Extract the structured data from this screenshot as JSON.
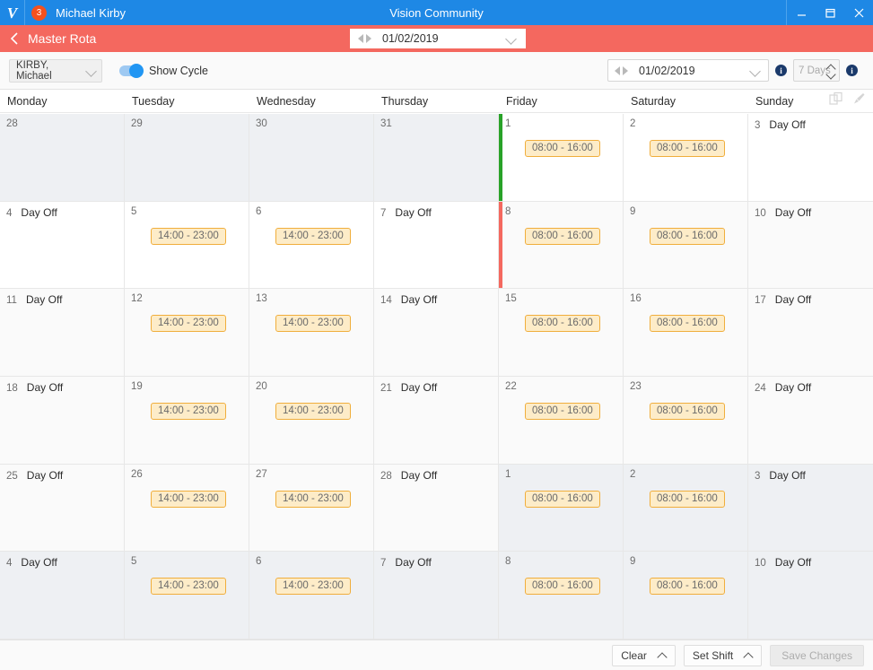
{
  "titlebar": {
    "logo": "vision-logo",
    "badge_count": "3",
    "user_name": "Michael Kirby",
    "app_title": "Vision Community",
    "minimize": "minimize-icon",
    "maximize": "maximize-icon",
    "close": "close-icon"
  },
  "subheader": {
    "back": "back-chevron-icon",
    "page_title": "Master Rota",
    "date_value": "01/02/2019"
  },
  "toolbar": {
    "staff_value": "KIRBY, Michael",
    "show_cycle_label": "Show Cycle",
    "show_cycle_on": true,
    "date_value": "01/02/2019",
    "days_value": "7 Days",
    "info_label": "i"
  },
  "day_headers": [
    "Monday",
    "Tuesday",
    "Wednesday",
    "Thursday",
    "Friday",
    "Saturday",
    "Sunday"
  ],
  "header_icons": [
    "copy-icon",
    "brush-icon"
  ],
  "calendar": {
    "weeks": [
      [
        {
          "day": "28",
          "state": "out",
          "label": "",
          "shift": "",
          "marker": ""
        },
        {
          "day": "29",
          "state": "out",
          "label": "",
          "shift": "",
          "marker": ""
        },
        {
          "day": "30",
          "state": "out",
          "label": "",
          "shift": "",
          "marker": ""
        },
        {
          "day": "31",
          "state": "out",
          "label": "",
          "shift": "",
          "marker": ""
        },
        {
          "day": "1",
          "state": "white",
          "label": "",
          "shift": "08:00 - 16:00",
          "marker": "green"
        },
        {
          "day": "2",
          "state": "white",
          "label": "",
          "shift": "08:00 - 16:00",
          "marker": ""
        },
        {
          "day": "3",
          "state": "white",
          "label": "Day Off",
          "shift": "",
          "marker": ""
        }
      ],
      [
        {
          "day": "4",
          "state": "white",
          "label": "Day Off",
          "shift": "",
          "marker": ""
        },
        {
          "day": "5",
          "state": "white",
          "label": "",
          "shift": "14:00 - 23:00",
          "marker": ""
        },
        {
          "day": "6",
          "state": "white",
          "label": "",
          "shift": "14:00 - 23:00",
          "marker": ""
        },
        {
          "day": "7",
          "state": "white",
          "label": "Day Off",
          "shift": "",
          "marker": ""
        },
        {
          "day": "8",
          "state": "past",
          "label": "",
          "shift": "08:00 - 16:00",
          "marker": "red"
        },
        {
          "day": "9",
          "state": "past",
          "label": "",
          "shift": "08:00 - 16:00",
          "marker": ""
        },
        {
          "day": "10",
          "state": "past",
          "label": "Day Off",
          "shift": "",
          "marker": ""
        }
      ],
      [
        {
          "day": "11",
          "state": "past",
          "label": "Day Off",
          "shift": "",
          "marker": ""
        },
        {
          "day": "12",
          "state": "past",
          "label": "",
          "shift": "14:00 - 23:00",
          "marker": ""
        },
        {
          "day": "13",
          "state": "past",
          "label": "",
          "shift": "14:00 - 23:00",
          "marker": ""
        },
        {
          "day": "14",
          "state": "past",
          "label": "Day Off",
          "shift": "",
          "marker": ""
        },
        {
          "day": "15",
          "state": "past",
          "label": "",
          "shift": "08:00 - 16:00",
          "marker": ""
        },
        {
          "day": "16",
          "state": "past",
          "label": "",
          "shift": "08:00 - 16:00",
          "marker": ""
        },
        {
          "day": "17",
          "state": "past",
          "label": "Day Off",
          "shift": "",
          "marker": ""
        }
      ],
      [
        {
          "day": "18",
          "state": "past",
          "label": "Day Off",
          "shift": "",
          "marker": ""
        },
        {
          "day": "19",
          "state": "past",
          "label": "",
          "shift": "14:00 - 23:00",
          "marker": ""
        },
        {
          "day": "20",
          "state": "past",
          "label": "",
          "shift": "14:00 - 23:00",
          "marker": ""
        },
        {
          "day": "21",
          "state": "past",
          "label": "Day Off",
          "shift": "",
          "marker": ""
        },
        {
          "day": "22",
          "state": "past",
          "label": "",
          "shift": "08:00 - 16:00",
          "marker": ""
        },
        {
          "day": "23",
          "state": "past",
          "label": "",
          "shift": "08:00 - 16:00",
          "marker": ""
        },
        {
          "day": "24",
          "state": "past",
          "label": "Day Off",
          "shift": "",
          "marker": ""
        }
      ],
      [
        {
          "day": "25",
          "state": "past",
          "label": "Day Off",
          "shift": "",
          "marker": ""
        },
        {
          "day": "26",
          "state": "past",
          "label": "",
          "shift": "14:00 - 23:00",
          "marker": ""
        },
        {
          "day": "27",
          "state": "past",
          "label": "",
          "shift": "14:00 - 23:00",
          "marker": ""
        },
        {
          "day": "28",
          "state": "past",
          "label": "Day Off",
          "shift": "",
          "marker": ""
        },
        {
          "day": "1",
          "state": "out",
          "label": "",
          "shift": "08:00 - 16:00",
          "marker": ""
        },
        {
          "day": "2",
          "state": "out",
          "label": "",
          "shift": "08:00 - 16:00",
          "marker": ""
        },
        {
          "day": "3",
          "state": "out",
          "label": "Day Off",
          "shift": "",
          "marker": ""
        }
      ],
      [
        {
          "day": "4",
          "state": "out",
          "label": "Day Off",
          "shift": "",
          "marker": ""
        },
        {
          "day": "5",
          "state": "out",
          "label": "",
          "shift": "14:00 - 23:00",
          "marker": ""
        },
        {
          "day": "6",
          "state": "out",
          "label": "",
          "shift": "14:00 - 23:00",
          "marker": ""
        },
        {
          "day": "7",
          "state": "out",
          "label": "Day Off",
          "shift": "",
          "marker": ""
        },
        {
          "day": "8",
          "state": "out",
          "label": "",
          "shift": "08:00 - 16:00",
          "marker": ""
        },
        {
          "day": "9",
          "state": "out",
          "label": "",
          "shift": "08:00 - 16:00",
          "marker": ""
        },
        {
          "day": "10",
          "state": "out",
          "label": "Day Off",
          "shift": "",
          "marker": ""
        }
      ]
    ]
  },
  "footer": {
    "clear_label": "Clear",
    "set_shift_label": "Set Shift",
    "save_label": "Save Changes"
  },
  "colors": {
    "titlebar": "#1e88e5",
    "subheader": "#f4685f",
    "badge": "#f4511e",
    "shift_bg": "#fdecc8",
    "shift_border": "#f0ae3c",
    "marker_green": "#28a228",
    "marker_red": "#f4685f",
    "toggle_on": "#2196f3",
    "info_icon": "#1b3a6b"
  }
}
